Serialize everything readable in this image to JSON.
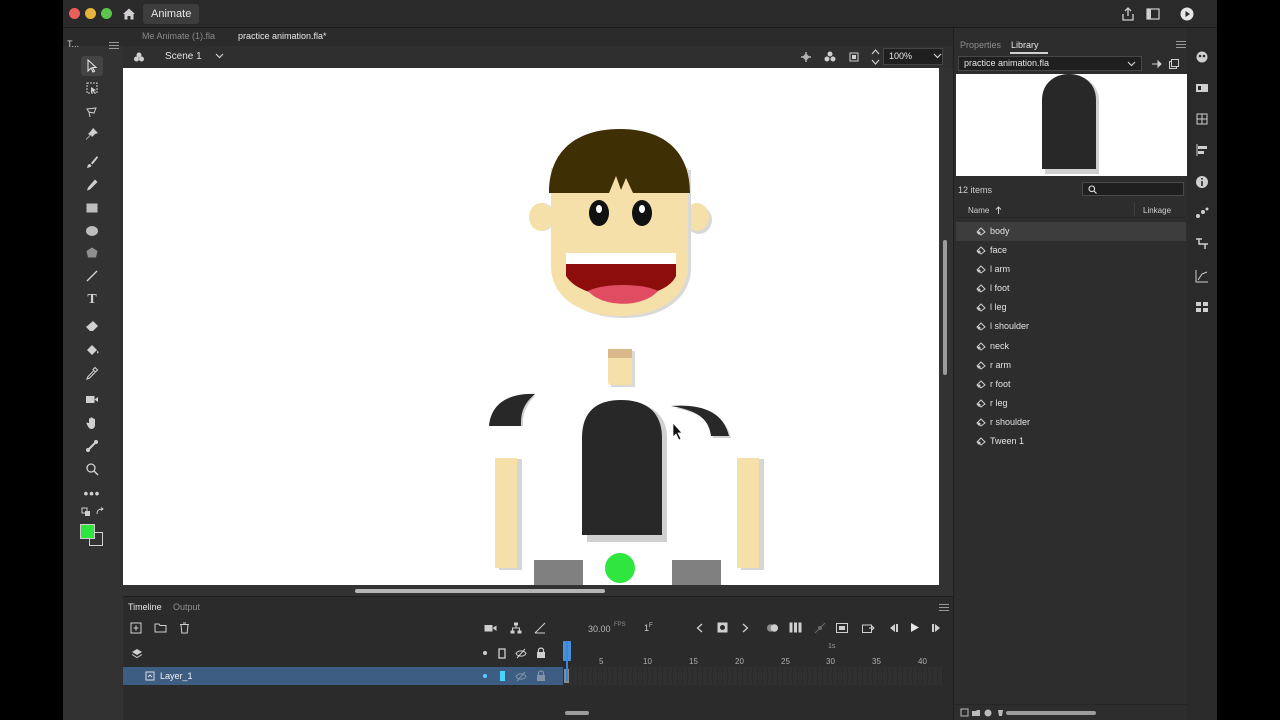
{
  "window": {
    "app_tab": "Animate"
  },
  "doc_tabs": [
    {
      "label": "Me Animate (1).fla",
      "active": false
    },
    {
      "label": "practice animation.fla*",
      "active": true
    }
  ],
  "tools_panel": {
    "title": "T..."
  },
  "stage_bar": {
    "scene": "Scene 1",
    "zoom": "100%"
  },
  "right_panel": {
    "tabs": [
      "Properties",
      "Library"
    ],
    "active_tab": "Library",
    "library_file": "practice animation.fla",
    "items_count": "12 items",
    "columns": {
      "name": "Name",
      "linkage": "Linkage"
    },
    "items": [
      "body",
      "face",
      "l arm",
      "l foot",
      "l leg",
      "l shoulder",
      "neck",
      "r arm",
      "r foot",
      "r leg",
      "r shoulder",
      "Tween 1"
    ],
    "selected_item": "body"
  },
  "timeline": {
    "tabs": [
      "Timeline",
      "Output"
    ],
    "active_tab": "Timeline",
    "fps": "30.00",
    "fps_unit": "FPS",
    "current_frame": "1",
    "current_frame_unit": "F",
    "ruler_ticks": [
      "5",
      "10",
      "15",
      "20",
      "25",
      "30",
      "35",
      "40"
    ],
    "seconds_marker": "1s",
    "layers": [
      {
        "name": "Layer_1"
      }
    ]
  },
  "colors": {
    "fill": "#2fe63f",
    "accent_layer": "#3d5d83",
    "playhead": "#3a86d8"
  }
}
